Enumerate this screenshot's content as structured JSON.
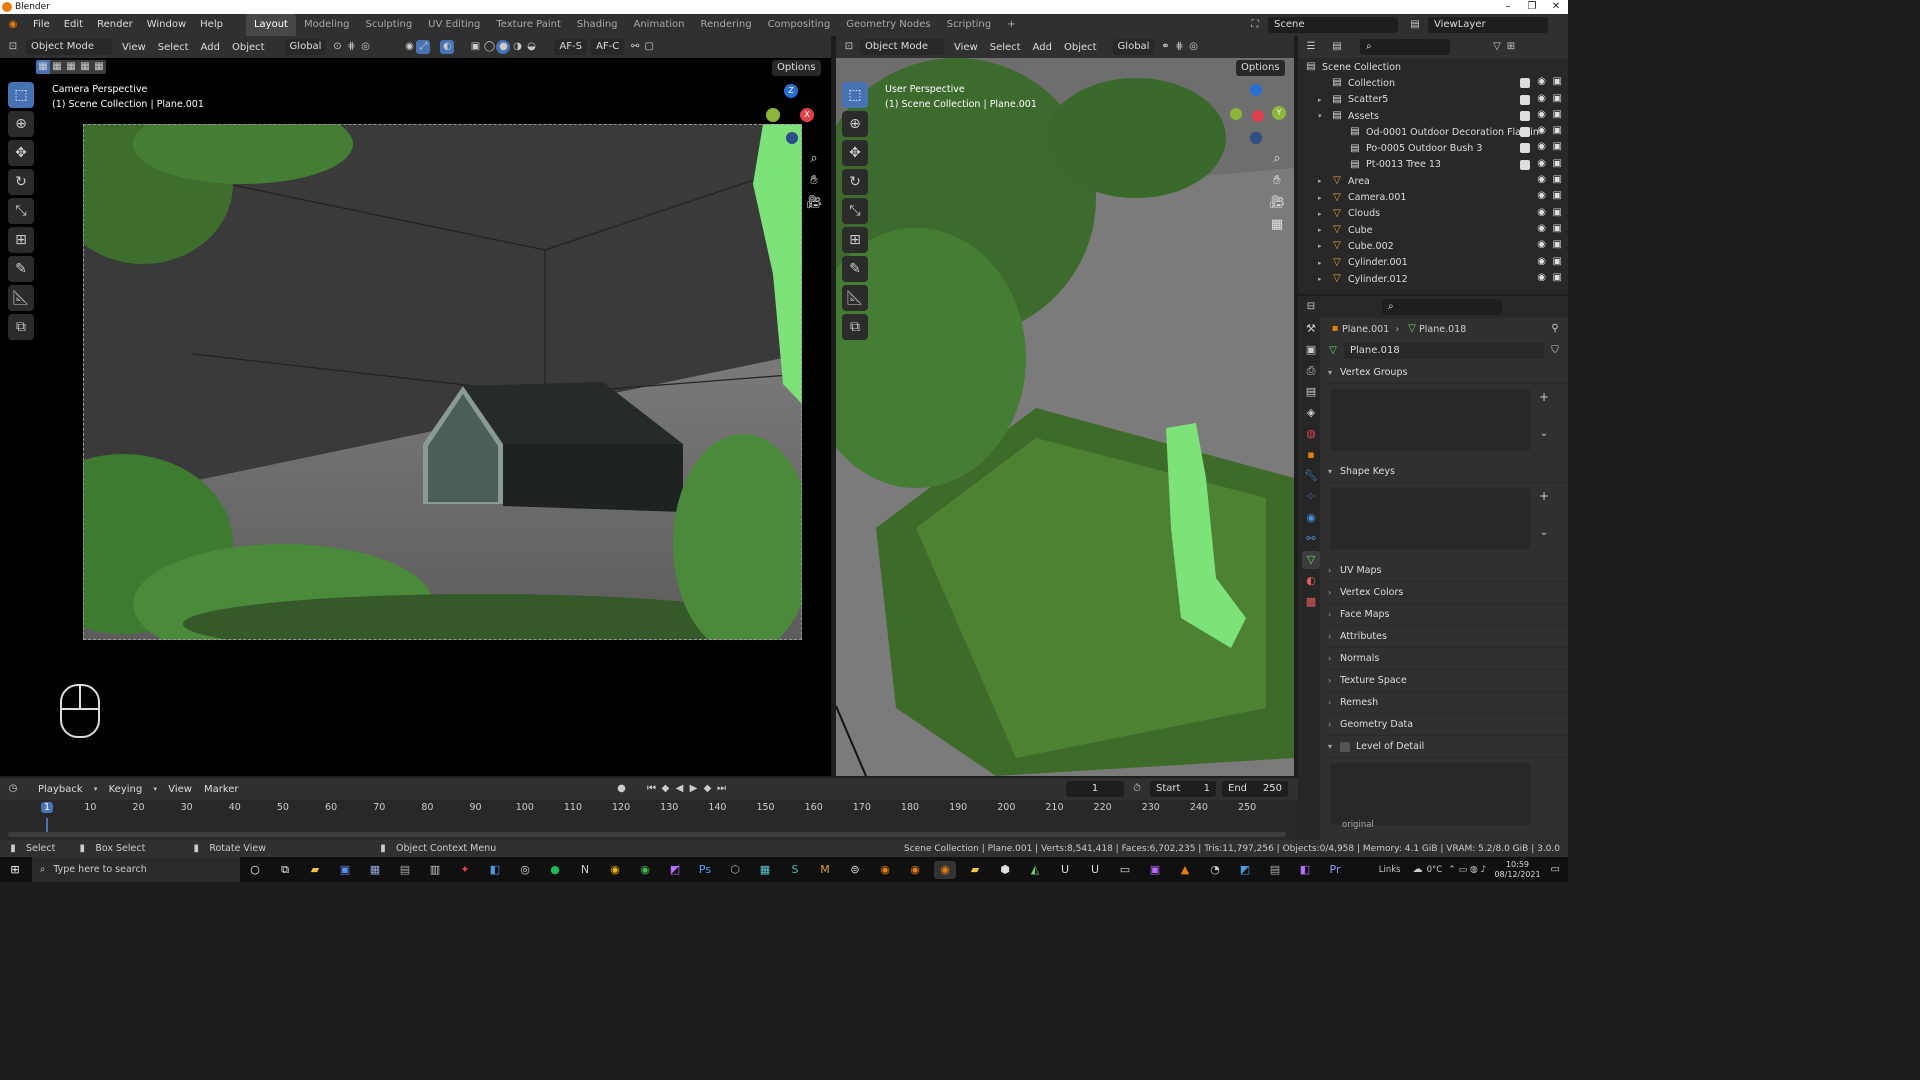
{
  "window": {
    "title": "Blender"
  },
  "menus": [
    "File",
    "Edit",
    "Render",
    "Window",
    "Help"
  ],
  "workspaces": [
    {
      "label": "Layout",
      "active": true
    },
    {
      "label": "Modeling"
    },
    {
      "label": "Sculpting"
    },
    {
      "label": "UV Editing"
    },
    {
      "label": "Texture Paint"
    },
    {
      "label": "Shading"
    },
    {
      "label": "Animation"
    },
    {
      "label": "Rendering"
    },
    {
      "label": "Compositing"
    },
    {
      "label": "Geometry Nodes"
    },
    {
      "label": "Scripting"
    }
  ],
  "workspace_add": "+",
  "scene": {
    "name": "Scene",
    "view_layer": "ViewLayer"
  },
  "viewport_left": {
    "mode": "Object Mode",
    "menus": [
      "View",
      "Select",
      "Add",
      "Object"
    ],
    "orientation": "Global",
    "af_s": "AF-S",
    "af_c": "AF-C",
    "options": "Options",
    "perspective": "Camera Perspective",
    "collection_path": "(1) Scene Collection | Plane.001"
  },
  "viewport_right": {
    "mode": "Object Mode",
    "menus": [
      "View",
      "Select",
      "Add",
      "Object"
    ],
    "orientation": "Global",
    "options": "Options",
    "perspective": "User Perspective",
    "collection_path": "(1) Scene Collection | Plane.001"
  },
  "gizmo_axes": {
    "x": "X",
    "y": "Y",
    "z": "Z"
  },
  "outliner": {
    "root": "Scene Collection",
    "rows": [
      {
        "label": "Collection",
        "indent": 1,
        "icon": "collection",
        "check": true
      },
      {
        "label": "Scatter5",
        "indent": 1,
        "icon": "collection",
        "check": true,
        "arrow": "▸"
      },
      {
        "label": "Assets",
        "indent": 1,
        "icon": "collection",
        "check": true,
        "arrow": "▾"
      },
      {
        "label": "Od-0001 Outdoor Decoration Flamin",
        "indent": 2,
        "icon": "collection",
        "check": true
      },
      {
        "label": "Po-0005 Outdoor Bush 3",
        "indent": 2,
        "icon": "collection",
        "check": true
      },
      {
        "label": "Pt-0013 Tree 13",
        "indent": 2,
        "icon": "collection",
        "check": true
      },
      {
        "label": "Area",
        "indent": 1,
        "icon": "object",
        "arrow": "▸"
      },
      {
        "label": "Camera.001",
        "indent": 1,
        "icon": "object",
        "arrow": "▸"
      },
      {
        "label": "Clouds",
        "indent": 1,
        "icon": "object",
        "arrow": "▸"
      },
      {
        "label": "Cube",
        "indent": 1,
        "icon": "object",
        "arrow": "▸"
      },
      {
        "label": "Cube.002",
        "indent": 1,
        "icon": "object",
        "arrow": "▸"
      },
      {
        "label": "Cylinder.001",
        "indent": 1,
        "icon": "object",
        "arrow": "▸"
      },
      {
        "label": "Cylinder.012",
        "indent": 1,
        "icon": "object",
        "arrow": "▸"
      }
    ]
  },
  "properties": {
    "breadcrumb_object": "Plane.001",
    "breadcrumb_data": "Plane.018",
    "mesh_name": "Plane.018",
    "sections": [
      {
        "label": "Vertex Groups",
        "open": true
      },
      {
        "label": "Shape Keys",
        "open": true
      },
      {
        "label": "UV Maps"
      },
      {
        "label": "Vertex Colors"
      },
      {
        "label": "Face Maps"
      },
      {
        "label": "Attributes"
      },
      {
        "label": "Normals"
      },
      {
        "label": "Texture Space"
      },
      {
        "label": "Remesh"
      },
      {
        "label": "Geometry Data"
      },
      {
        "label": "Level of Detail",
        "open": true
      }
    ],
    "lod_label": "original"
  },
  "timeline": {
    "menus": [
      "Playback",
      "Keying",
      "View",
      "Marker"
    ],
    "current_frame": "1",
    "start_label": "Start",
    "start": "1",
    "end_label": "End",
    "end": "250",
    "ticks": [
      "1",
      "10",
      "20",
      "30",
      "40",
      "50",
      "60",
      "70",
      "80",
      "90",
      "100",
      "110",
      "120",
      "130",
      "140",
      "150",
      "160",
      "170",
      "180",
      "190",
      "200",
      "210",
      "220",
      "230",
      "240",
      "250"
    ]
  },
  "statusbar": {
    "select": "Select",
    "box_select": "Box Select",
    "rotate_view": "Rotate View",
    "context_menu": "Object Context Menu",
    "stats": "Scene Collection | Plane.001 | Verts:8,541,418 | Faces:6,702,235 | Tris:11,797,256 | Objects:0/4,958 | Memory: 4.1 GiB | VRAM: 5.2/8.0 GiB | 3.0.0"
  },
  "taskbar": {
    "search_placeholder": "Type here to search",
    "links": "Links",
    "temperature": "0°C",
    "time": "10:59",
    "date": "08/12/2021"
  },
  "colors": {
    "accent_blue": "#4772b3",
    "selection_green": "#7de27a",
    "panel": "#303030",
    "viewport_bg": "#000000"
  }
}
